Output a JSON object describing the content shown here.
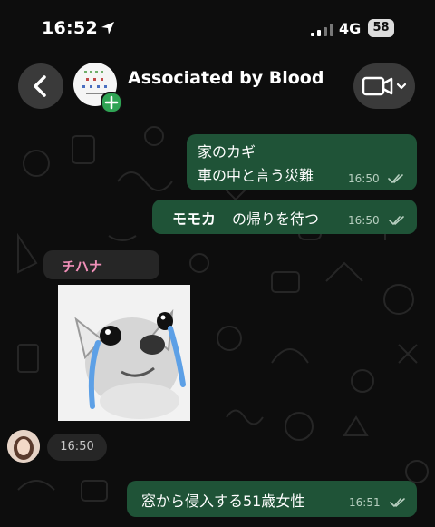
{
  "status_bar": {
    "time": "16:52",
    "network": "4G",
    "battery": "58"
  },
  "header": {
    "title": "Associated by Blood"
  },
  "messages": {
    "m1": {
      "line1": "家のカギ",
      "line2": "車の中と言う災難",
      "time": "16:50"
    },
    "m2": {
      "bold": "モモカ",
      "text": "の帰りを待つ",
      "time": "16:50"
    },
    "m3": {
      "sender": "チハナ",
      "time": "16:50"
    },
    "m4": {
      "text": "窓から侵入する51歳女性",
      "time": "16:51"
    }
  },
  "colors": {
    "outgoing_bubble": "#1f5337",
    "incoming_bubble": "#262626",
    "sender_name": "#f08fb8",
    "badge_green": "#2fa454"
  }
}
